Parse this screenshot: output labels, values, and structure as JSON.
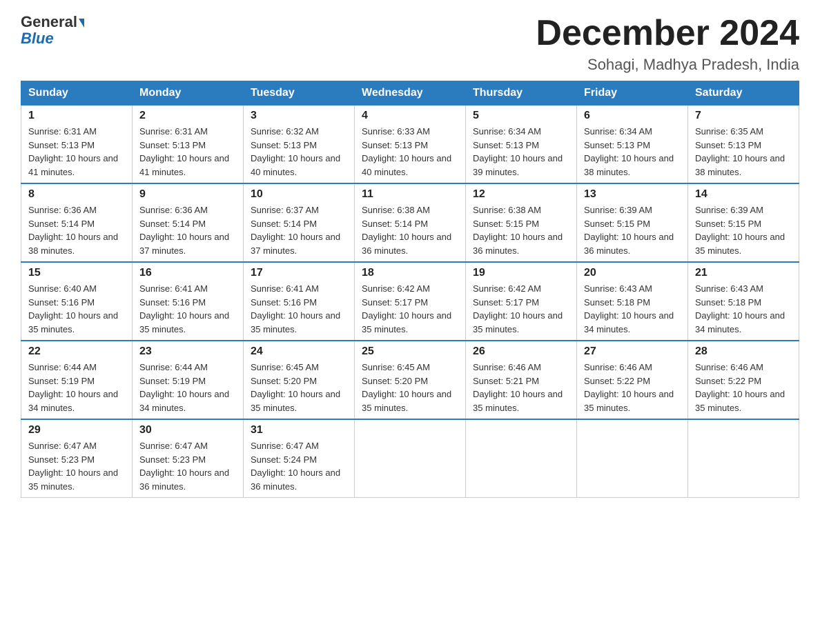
{
  "header": {
    "logo_general": "General",
    "logo_blue": "Blue",
    "month_title": "December 2024",
    "location": "Sohagi, Madhya Pradesh, India"
  },
  "days_of_week": [
    "Sunday",
    "Monday",
    "Tuesday",
    "Wednesday",
    "Thursday",
    "Friday",
    "Saturday"
  ],
  "weeks": [
    [
      {
        "day": "1",
        "sunrise": "6:31 AM",
        "sunset": "5:13 PM",
        "daylight": "10 hours and 41 minutes."
      },
      {
        "day": "2",
        "sunrise": "6:31 AM",
        "sunset": "5:13 PM",
        "daylight": "10 hours and 41 minutes."
      },
      {
        "day": "3",
        "sunrise": "6:32 AM",
        "sunset": "5:13 PM",
        "daylight": "10 hours and 40 minutes."
      },
      {
        "day": "4",
        "sunrise": "6:33 AM",
        "sunset": "5:13 PM",
        "daylight": "10 hours and 40 minutes."
      },
      {
        "day": "5",
        "sunrise": "6:34 AM",
        "sunset": "5:13 PM",
        "daylight": "10 hours and 39 minutes."
      },
      {
        "day": "6",
        "sunrise": "6:34 AM",
        "sunset": "5:13 PM",
        "daylight": "10 hours and 38 minutes."
      },
      {
        "day": "7",
        "sunrise": "6:35 AM",
        "sunset": "5:13 PM",
        "daylight": "10 hours and 38 minutes."
      }
    ],
    [
      {
        "day": "8",
        "sunrise": "6:36 AM",
        "sunset": "5:14 PM",
        "daylight": "10 hours and 38 minutes."
      },
      {
        "day": "9",
        "sunrise": "6:36 AM",
        "sunset": "5:14 PM",
        "daylight": "10 hours and 37 minutes."
      },
      {
        "day": "10",
        "sunrise": "6:37 AM",
        "sunset": "5:14 PM",
        "daylight": "10 hours and 37 minutes."
      },
      {
        "day": "11",
        "sunrise": "6:38 AM",
        "sunset": "5:14 PM",
        "daylight": "10 hours and 36 minutes."
      },
      {
        "day": "12",
        "sunrise": "6:38 AM",
        "sunset": "5:15 PM",
        "daylight": "10 hours and 36 minutes."
      },
      {
        "day": "13",
        "sunrise": "6:39 AM",
        "sunset": "5:15 PM",
        "daylight": "10 hours and 36 minutes."
      },
      {
        "day": "14",
        "sunrise": "6:39 AM",
        "sunset": "5:15 PM",
        "daylight": "10 hours and 35 minutes."
      }
    ],
    [
      {
        "day": "15",
        "sunrise": "6:40 AM",
        "sunset": "5:16 PM",
        "daylight": "10 hours and 35 minutes."
      },
      {
        "day": "16",
        "sunrise": "6:41 AM",
        "sunset": "5:16 PM",
        "daylight": "10 hours and 35 minutes."
      },
      {
        "day": "17",
        "sunrise": "6:41 AM",
        "sunset": "5:16 PM",
        "daylight": "10 hours and 35 minutes."
      },
      {
        "day": "18",
        "sunrise": "6:42 AM",
        "sunset": "5:17 PM",
        "daylight": "10 hours and 35 minutes."
      },
      {
        "day": "19",
        "sunrise": "6:42 AM",
        "sunset": "5:17 PM",
        "daylight": "10 hours and 35 minutes."
      },
      {
        "day": "20",
        "sunrise": "6:43 AM",
        "sunset": "5:18 PM",
        "daylight": "10 hours and 34 minutes."
      },
      {
        "day": "21",
        "sunrise": "6:43 AM",
        "sunset": "5:18 PM",
        "daylight": "10 hours and 34 minutes."
      }
    ],
    [
      {
        "day": "22",
        "sunrise": "6:44 AM",
        "sunset": "5:19 PM",
        "daylight": "10 hours and 34 minutes."
      },
      {
        "day": "23",
        "sunrise": "6:44 AM",
        "sunset": "5:19 PM",
        "daylight": "10 hours and 34 minutes."
      },
      {
        "day": "24",
        "sunrise": "6:45 AM",
        "sunset": "5:20 PM",
        "daylight": "10 hours and 35 minutes."
      },
      {
        "day": "25",
        "sunrise": "6:45 AM",
        "sunset": "5:20 PM",
        "daylight": "10 hours and 35 minutes."
      },
      {
        "day": "26",
        "sunrise": "6:46 AM",
        "sunset": "5:21 PM",
        "daylight": "10 hours and 35 minutes."
      },
      {
        "day": "27",
        "sunrise": "6:46 AM",
        "sunset": "5:22 PM",
        "daylight": "10 hours and 35 minutes."
      },
      {
        "day": "28",
        "sunrise": "6:46 AM",
        "sunset": "5:22 PM",
        "daylight": "10 hours and 35 minutes."
      }
    ],
    [
      {
        "day": "29",
        "sunrise": "6:47 AM",
        "sunset": "5:23 PM",
        "daylight": "10 hours and 35 minutes."
      },
      {
        "day": "30",
        "sunrise": "6:47 AM",
        "sunset": "5:23 PM",
        "daylight": "10 hours and 36 minutes."
      },
      {
        "day": "31",
        "sunrise": "6:47 AM",
        "sunset": "5:24 PM",
        "daylight": "10 hours and 36 minutes."
      },
      null,
      null,
      null,
      null
    ]
  ],
  "labels": {
    "sunrise_prefix": "Sunrise: ",
    "sunset_prefix": "Sunset: ",
    "daylight_prefix": "Daylight: "
  }
}
